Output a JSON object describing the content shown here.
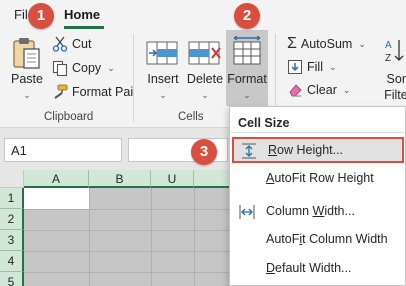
{
  "tabs": {
    "file": "File",
    "home": "Home"
  },
  "steps": {
    "one": "1",
    "two": "2",
    "three": "3"
  },
  "clipboard": {
    "paste": "Paste",
    "cut": "Cut",
    "copy": "Copy",
    "format_painter": "Format Pai",
    "group_label": "Clipboard"
  },
  "cells": {
    "insert": "Insert",
    "delete": "Delete",
    "format": "Format",
    "group_label": "Cells"
  },
  "editing": {
    "autosum": "AutoSum",
    "fill": "Fill",
    "clear": "Clear",
    "sort_line1": "Sort",
    "sort_line2": "Filter"
  },
  "formula_bar": {
    "name_box": "A1"
  },
  "grid": {
    "columns": [
      "A",
      "B",
      "U"
    ],
    "rows": [
      "1",
      "2",
      "3",
      "4",
      "5"
    ]
  },
  "menu": {
    "header": "Cell Size",
    "row_height": {
      "pre": "",
      "ul": "R",
      "post": "ow Height..."
    },
    "autofit_row": {
      "pre": "",
      "ul": "A",
      "post": "utoFit Row Height"
    },
    "column_width": {
      "pre": "Column ",
      "ul": "W",
      "post": "idth..."
    },
    "autofit_col": {
      "pre": "AutoF",
      "ul": "i",
      "post": "t Column Width"
    },
    "default_width": {
      "pre": "",
      "ul": "D",
      "post": "efault Width..."
    }
  },
  "colors": {
    "accent_green": "#217346",
    "step_badge": "#d94f3f",
    "highlight_border": "#d94f3f",
    "selected_header": "#d2e8d6",
    "selection_fill": "#c6c6c6"
  },
  "icons": [
    "paste-icon",
    "cut-icon",
    "copy-icon",
    "format-painter-icon",
    "insert-cells-icon",
    "delete-cells-icon",
    "format-cells-icon",
    "autosum-icon",
    "fill-icon",
    "clear-icon",
    "sort-filter-icon",
    "row-height-icon",
    "column-width-icon",
    "chevron-down-icon"
  ]
}
